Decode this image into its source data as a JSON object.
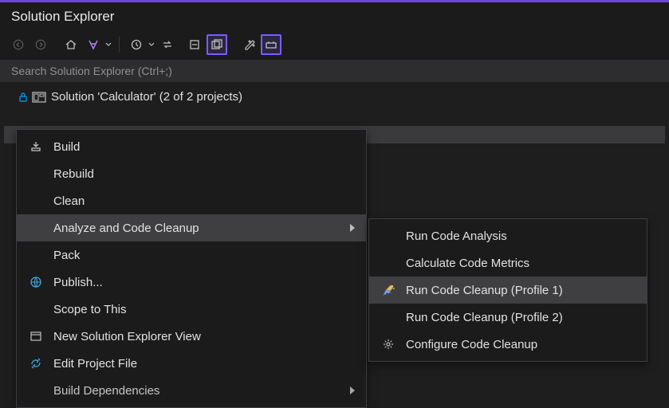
{
  "title": "Solution Explorer",
  "search_placeholder": "Search Solution Explorer (Ctrl+;)",
  "solution_label": "Solution 'Calculator' (2 of 2 projects)",
  "context_menu": {
    "build": "Build",
    "rebuild": "Rebuild",
    "clean": "Clean",
    "analyze": "Analyze and Code Cleanup",
    "pack": "Pack",
    "publish": "Publish...",
    "scope": "Scope to This",
    "new_view": "New Solution Explorer View",
    "edit_project": "Edit Project File",
    "build_deps": "Build Dependencies"
  },
  "submenu": {
    "run_analysis": "Run Code Analysis",
    "calc_metrics": "Calculate Code Metrics",
    "cleanup_p1": "Run Code Cleanup (Profile 1)",
    "cleanup_p2": "Run Code Cleanup (Profile 2)",
    "configure": "Configure Code Cleanup"
  }
}
